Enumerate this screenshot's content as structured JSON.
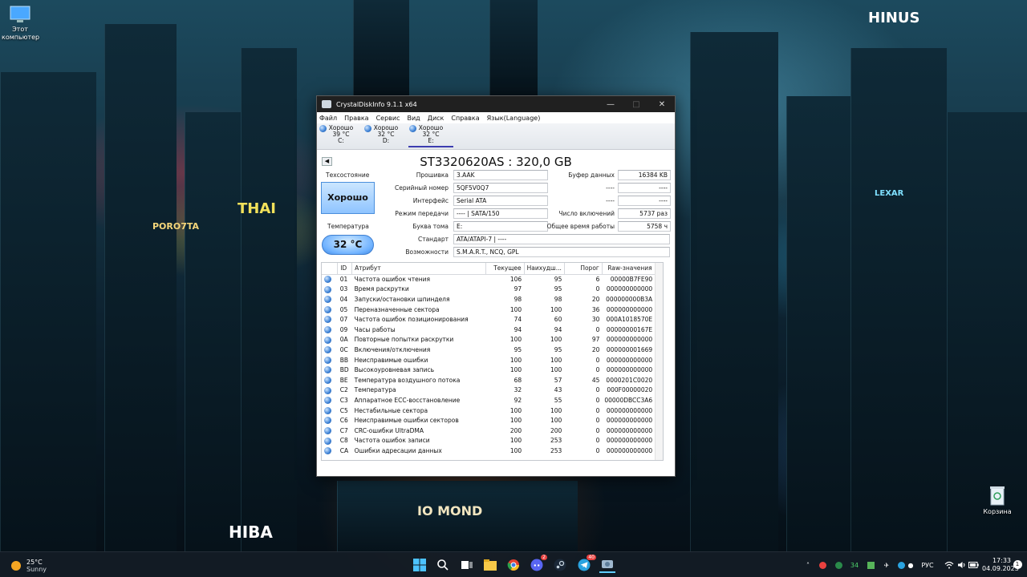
{
  "desktop": {
    "icons": [
      {
        "label_line1": "Этот",
        "label_line2": "компьютер"
      },
      {
        "label": "Корзина"
      }
    ],
    "signs": [
      "HINUS",
      "PORO7TA",
      "THAI",
      "LEXAR",
      "HIBA",
      "IO MOND"
    ]
  },
  "window": {
    "title": "CrystalDiskInfo 9.1.1 x64",
    "menu": [
      "Файл",
      "Правка",
      "Сервис",
      "Вид",
      "Диск",
      "Справка",
      "Язык(Language)"
    ],
    "drives": [
      {
        "status": "Хорошо",
        "temp": "39 °C",
        "letter": "C:"
      },
      {
        "status": "Хорошо",
        "temp": "32 °C",
        "letter": "D:"
      },
      {
        "status": "Хорошо",
        "temp": "32 °C",
        "letter": "E:"
      }
    ],
    "model": "ST3320620AS : 320,0 GB",
    "health_label": "Техсостояние",
    "health_value": "Хорошо",
    "temp_label": "Температура",
    "temp_value": "32 °C",
    "info_left": {
      "firmware_label": "Прошивка",
      "firmware": "3.AAK",
      "serial_label": "Серийный номер",
      "serial": "5QF5V0Q7",
      "interface_label": "Интерфейс",
      "interface": "Serial ATA",
      "transfer_label": "Режим передачи",
      "transfer": "---- | SATA/150",
      "letter_label": "Буква тома",
      "letter": "E:",
      "standard_label": "Стандарт",
      "standard": "ATA/ATAPI-7 | ----",
      "features_label": "Возможности",
      "features": "S.M.A.R.T., NCQ, GPL"
    },
    "info_right": {
      "buffer_label": "Буфер данных",
      "buffer": "16384 KB",
      "blank1_label": "----",
      "blank1": "----",
      "blank2_label": "----",
      "blank2": "----",
      "power_count_label": "Число включений",
      "power_count": "5737 раз",
      "power_hours_label": "Общее время работы",
      "power_hours": "5758 ч"
    },
    "smart_headers": [
      "ID",
      "Атрибут",
      "Текущее",
      "Наихудш...",
      "Порог",
      "Raw-значения"
    ],
    "smart_rows": [
      [
        "01",
        "Частота ошибок чтения",
        "106",
        "95",
        "6",
        "00000B7FE90"
      ],
      [
        "03",
        "Время раскрутки",
        "97",
        "95",
        "0",
        "000000000000"
      ],
      [
        "04",
        "Запуски/остановки шпинделя",
        "98",
        "98",
        "20",
        "000000000B3A"
      ],
      [
        "05",
        "Переназначенные сектора",
        "100",
        "100",
        "36",
        "000000000000"
      ],
      [
        "07",
        "Частота ошибок позиционирования",
        "74",
        "60",
        "30",
        "000A1018570E"
      ],
      [
        "09",
        "Часы работы",
        "94",
        "94",
        "0",
        "00000000167E"
      ],
      [
        "0A",
        "Повторные попытки раскрутки",
        "100",
        "100",
        "97",
        "000000000000"
      ],
      [
        "0C",
        "Включения/отключения",
        "95",
        "95",
        "20",
        "000000001669"
      ],
      [
        "BB",
        "Неисправимые ошибки",
        "100",
        "100",
        "0",
        "000000000000"
      ],
      [
        "BD",
        "Высокоуровневая запись",
        "100",
        "100",
        "0",
        "000000000000"
      ],
      [
        "BE",
        "Температура воздушного потока",
        "68",
        "57",
        "45",
        "0000201C0020"
      ],
      [
        "C2",
        "Температура",
        "32",
        "43",
        "0",
        "000F00000020"
      ],
      [
        "C3",
        "Аппаратное ECC-восстановление",
        "92",
        "55",
        "0",
        "00000DBCC3A6"
      ],
      [
        "C5",
        "Нестабильные сектора",
        "100",
        "100",
        "0",
        "000000000000"
      ],
      [
        "C6",
        "Неисправимые ошибки секторов",
        "100",
        "100",
        "0",
        "000000000000"
      ],
      [
        "C7",
        "CRC-ошибки UltraDMA",
        "200",
        "200",
        "0",
        "000000000000"
      ],
      [
        "C8",
        "Частота ошибок записи",
        "100",
        "253",
        "0",
        "000000000000"
      ],
      [
        "CA",
        "Ошибки адресации данных",
        "100",
        "253",
        "0",
        "000000000000"
      ]
    ]
  },
  "taskbar": {
    "weather_temp": "25°C",
    "weather_desc": "Sunny",
    "tray_count": "34",
    "lang": "РУС",
    "time": "17:33",
    "date": "04.09.2023",
    "discord_badge": "2",
    "telegram_badge": "40"
  }
}
